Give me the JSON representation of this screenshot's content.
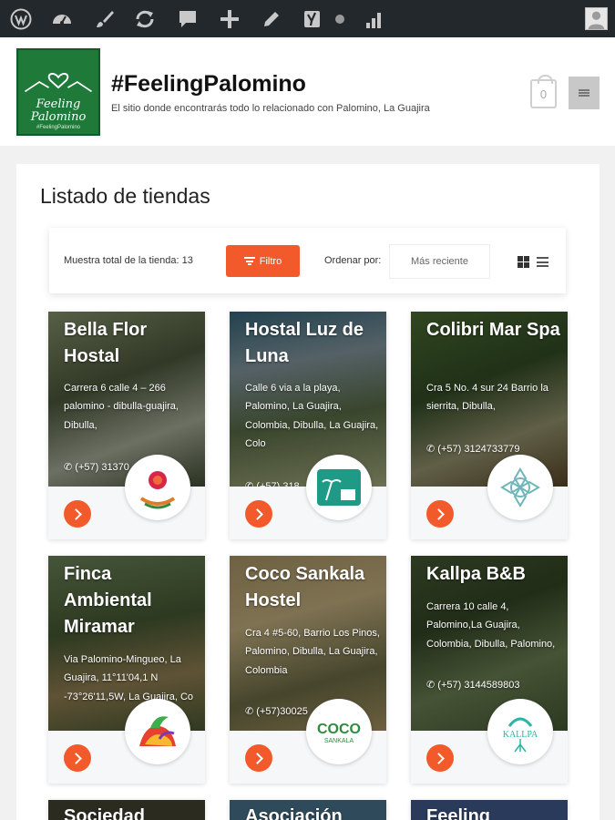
{
  "admin_bar": {
    "icons": [
      "wordpress-icon",
      "dashboard-icon",
      "customize-brush-icon",
      "updates-icon",
      "comments-icon",
      "new-plus-icon",
      "edit-pencil-icon",
      "yoast-seo-icon",
      "status-dot-icon",
      "stats-icon",
      "user-avatar-icon"
    ]
  },
  "site": {
    "logo_line1": "Feeling",
    "logo_line2": "Palomino",
    "logo_tagline": "#FeelingPalomino",
    "title": "#FeelingPalomino",
    "description": "El sitio donde encontrarás todo lo relacionado con Palomino, La Guajira",
    "cart_count": "0"
  },
  "page": {
    "title": "Listado de tiendas"
  },
  "toolbar": {
    "total_label": "Muestra total de la tienda: 13",
    "filter_label": "Filtro",
    "sort_label": "Ordenar por:",
    "sort_value": "Más reciente",
    "accent": "#f35a2b"
  },
  "stores": [
    {
      "name": "Bella Flor Hostal",
      "address": "Carrera 6 calle 4 – 266 palomino - dibulla-guajira, Dibulla,",
      "phone": "(+57) 31370",
      "logo": "bella-flor-logo"
    },
    {
      "name": "Hostal Luz de Luna",
      "address": "Calle 6 via a la playa, Palomino, La Guajira, Colombia, Dibulla, La Guajira, Colo",
      "phone": "(+57) 318",
      "logo": "luz-de-luna-logo"
    },
    {
      "name": "Colibri Mar Spa",
      "address": "Cra 5 No. 4 sur 24 Barrio la sierrita, Dibulla,",
      "phone": "(+57) 3124733779",
      "logo": "colibri-mar-logo"
    },
    {
      "name": "Finca Ambiental Miramar",
      "address": "Via Palomino-Mingueo, La Guajira, 11°11'04,1 N -73°26'11,5W, La Guajira, Co",
      "phone": "",
      "logo": "miramar-logo"
    },
    {
      "name": "Coco Sankala Hostel",
      "address": "Cra 4 #5-60, Barrio Los Pinos, Palomino, Dibulla, La Guajira, Colombia",
      "phone": "(+57)30025",
      "logo": "coco-sankala-logo",
      "logo_text": "COCO",
      "logo_subtext": "SANKALA"
    },
    {
      "name": "Kallpa B&B",
      "address": "Carrera 10 calle 4, Palomino,La Guajira, Colombia, Dibulla, Palomino,",
      "phone": "(+57) 3144589803",
      "logo": "kallpa-logo",
      "logo_text": "KALLPA"
    },
    {
      "name": "Sociedad",
      "address": "",
      "phone": "",
      "logo": ""
    },
    {
      "name": "Asociación",
      "address": "",
      "phone": "",
      "logo": ""
    },
    {
      "name": "Feeling",
      "address": "",
      "phone": "",
      "logo": ""
    }
  ]
}
